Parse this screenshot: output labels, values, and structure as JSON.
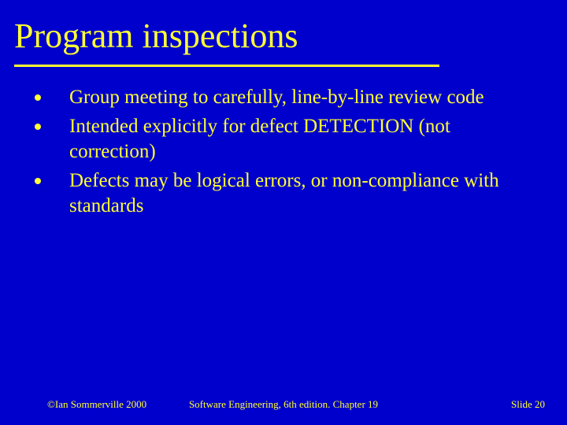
{
  "slide": {
    "title": "Program inspections",
    "bullets": [
      "Group meeting to carefully, line-by-line review code",
      "Intended explicitly for defect DETECTION (not correction)",
      "Defects may be logical errors, or non-compliance with standards"
    ],
    "footer": {
      "left": "©Ian Sommerville 2000",
      "center": "Software Engineering, 6th edition. Chapter 19",
      "right": "Slide 20"
    }
  }
}
